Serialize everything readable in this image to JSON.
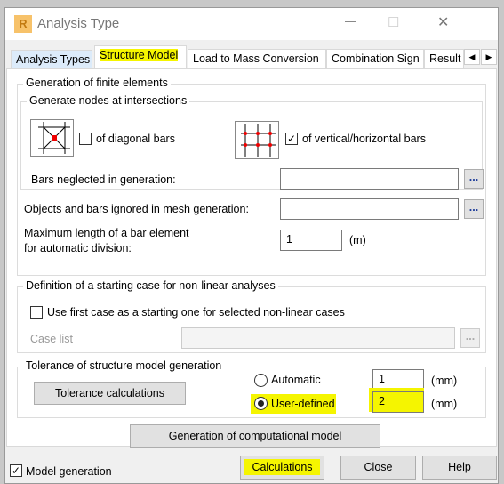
{
  "window": {
    "title": "Analysis Type",
    "minimize": "—",
    "maximize": "☐",
    "close": "✕"
  },
  "tabs": [
    {
      "label": "Analysis Types"
    },
    {
      "label": "Structure Model",
      "active": true
    },
    {
      "label": "Load to Mass Conversion"
    },
    {
      "label": "Combination Sign"
    },
    {
      "label": "Result"
    }
  ],
  "tab_scroll": {
    "left": "◀",
    "right": "▶"
  },
  "finite": {
    "title": "Generation of finite elements",
    "nodes_title": "Generate nodes at intersections",
    "diagonal": {
      "label": "of diagonal bars",
      "checked": false
    },
    "vertical": {
      "label": "of vertical/horizontal bars",
      "checked": true
    },
    "neglected_label": "Bars neglected in generation:",
    "neglected_value": "",
    "ignored_label": "Objects and bars ignored in mesh generation:",
    "ignored_value": "",
    "maxlen_label1": "Maximum length of a bar element",
    "maxlen_label2": "for automatic division:",
    "maxlen_value": "1",
    "maxlen_unit": "(m)",
    "browse": "..."
  },
  "nonlinear": {
    "title": "Definition of a starting case for non-linear analyses",
    "checkbox_label": "Use first case as a starting one for selected non-linear cases",
    "checked": false,
    "case_list_label": "Case list",
    "case_list_value": ""
  },
  "tolerance": {
    "title": "Tolerance of structure model generation",
    "calc_button": "Tolerance calculations",
    "automatic": "Automatic",
    "automatic_value": "1",
    "user_defined": "User-defined",
    "user_value": "2",
    "unit": "(mm)",
    "selected": "User-defined"
  },
  "generate_button": "Generation of computational model",
  "footer": {
    "model_generation": "Model generation",
    "model_generation_checked": true,
    "calculations": "Calculations",
    "close": "Close",
    "help": "Help"
  },
  "colors": {
    "highlight": "#f5f500",
    "logo": "#f0a830"
  }
}
